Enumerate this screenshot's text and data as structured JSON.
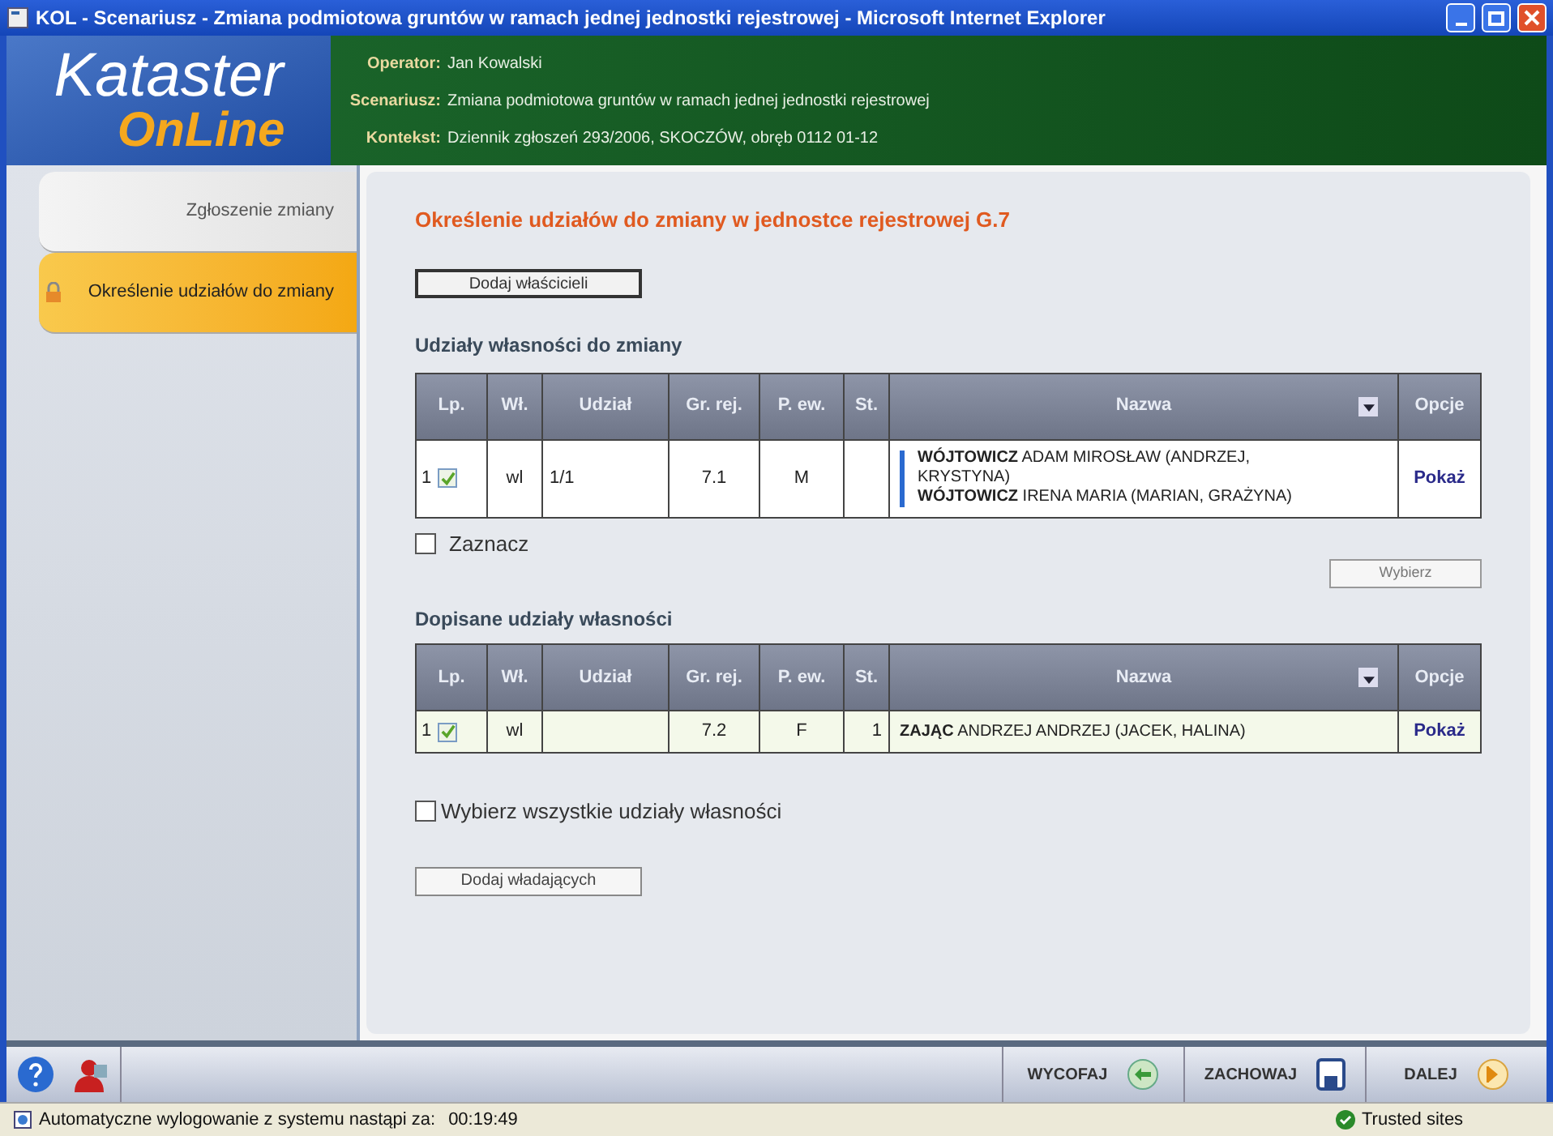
{
  "window": {
    "title": "KOL - Scenariusz - Zmiana podmiotowa gruntów w ramach jednej jednostki rejestrowej - Microsoft Internet Explorer"
  },
  "logo": {
    "line_1": "Kataster",
    "line_2": "OnLine"
  },
  "header": [
    {
      "label": "Operator:",
      "value": "Jan Kowalski"
    },
    {
      "label": "Scenariusz:",
      "value": "Zmiana podmiotowa gruntów w ramach jednej jednostki rejestrowej"
    },
    {
      "label": "Kontekst:",
      "value": "Dziennik zgłoszeń 293/2006, SKOCZÓW, obręb 0112 01-12"
    }
  ],
  "sidebar": {
    "items": [
      {
        "label": "Zgłoszenie zmiany",
        "selected": false
      },
      {
        "label": "Określenie udziałów do zmiany",
        "selected": true
      }
    ]
  },
  "page_title": "Określenie udziałów do zmiany w jednostce rejestrowej G.7",
  "add_owners_button": "Dodaj właścicieli",
  "tables": [
    {
      "title": "Udziały własności do zmiany",
      "columns": [
        "Lp.",
        "Wł.",
        "Udział",
        "Gr. rej.",
        "P. ew.",
        "St.",
        "Nazwa",
        "Opcje"
      ],
      "rows": [
        {
          "lp": "1",
          "checked": true,
          "wl": "wl",
          "udzial": "1/1",
          "gr_rej": "7.1",
          "p_ew": "M",
          "st": "",
          "names": [
            "**WÓJTOWICZ** ADAM MIROSŁAW (ANDRZEJ, KRYSTYNA)",
            "**WÓJTOWICZ** IRENA MARIA (MARIAN, GRAŻYNA)"
          ],
          "option": "Pokaż"
        }
      ],
      "select_checkbox": {
        "label": "Zaznacz",
        "checked": false
      },
      "select_button": "Wybierz"
    },
    {
      "title": "Dopisane udziały własności",
      "columns": [
        "Lp.",
        "Wł.",
        "Udział",
        "Gr. rej.",
        "P. ew.",
        "St.",
        "Nazwa",
        "Opcje"
      ],
      "rows": [
        {
          "lp": "1",
          "checked": true,
          "wl": "wl",
          "udzial": "",
          "gr_rej": "7.2",
          "p_ew": "F",
          "st": "1",
          "names": [
            "**ZAJĄC** ANDRZEJ ANDRZEJ (JACEK, HALINA)"
          ],
          "option": "Pokaż"
        }
      ]
    }
  ],
  "select_all": {
    "label": "Wybierz wszystkie udziały własności",
    "checked": false
  },
  "add_holders_button": "Dodaj władających",
  "toolbar": {
    "buttons": [
      {
        "label": "WYCOFAJ",
        "kind": "back"
      },
      {
        "label": "ZACHOWAJ",
        "kind": "save"
      },
      {
        "label": "DALEJ",
        "kind": "next"
      }
    ]
  },
  "status_bar": {
    "message": "Automatyczne wylogowanie z systemu nastąpi za:",
    "timer": "00:19:49",
    "zone": "Trusted sites"
  }
}
